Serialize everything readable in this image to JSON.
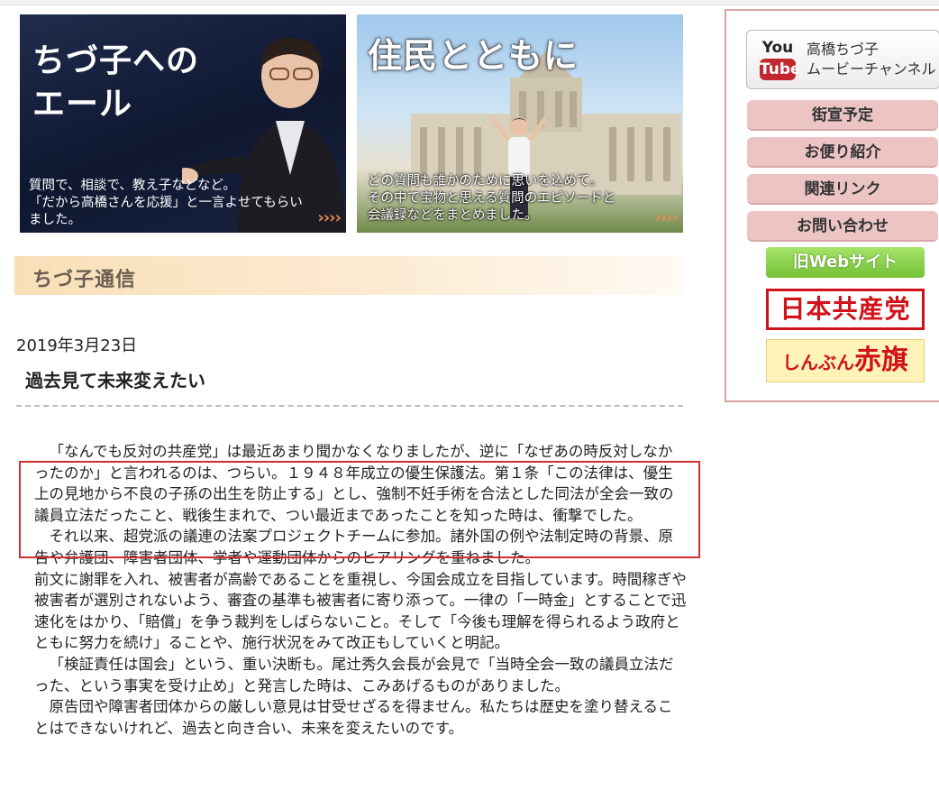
{
  "banners": [
    {
      "title": "ちづ子への\nエール",
      "caption": "質問で、相談で、教え子などなど。\n「だから高橋さんを応援」と一言よせてもらい\nました。",
      "arrow": "››››"
    },
    {
      "title": "住民とともに",
      "caption": "どの質問も誰かのために思いを込めて。\nその中で宝物と思える質問のエピソードと\n会議録などをまとめました。",
      "arrow": "››››"
    }
  ],
  "section": {
    "title": "ちづ子通信"
  },
  "post": {
    "date": "2019年3月23日",
    "title": "過去見て未来変えたい",
    "paragraphs": [
      "「なんでも反対の共産党」は最近あまり聞かなくなりましたが、逆に「なぜあの時反対しなかったのか」と言われるのは、つらい。１９４８年成立の優生保護法。第１条「この法律は、優生上の見地から不良の子孫の出生を防止する」とし、強制不妊手術を合法とした同法が全会一致の議員立法だったこと、戦後生まれで、つい最近まであったことを知った時は、衝撃でした。",
      "それ以来、超党派の議連の法案プロジェクトチームに参加。諸外国の例や法制定時の背景、原告や弁護団、障害者団体、学者や運動団体からのヒアリングを重ねました。",
      "前文に謝罪を入れ、被害者が高齢であることを重視し、今国会成立を目指しています。時間稼ぎや被害者が選別されないよう、審査の基準も被害者に寄り添って。一律の「一時金」とすることで迅速化をはかり、「賠償」を争う裁判をしばらないこと。そして「今後も理解を得られるよう政府とともに努力を続け」ることや、施行状況をみて改正もしていくと明記。",
      "「検証責任は国会」という、重い決断も。尾辻秀久会長が会見で「当時全会一致の議員立法だった、という事実を受け止め」と発言した時は、こみあげるものがありました。",
      "原告団や障害者団体からの厳しい意見は甘受せざるを得ません。私たちは歴史を塗り替えることはできないけれど、過去と向き合い、未来を変えたいのです。"
    ]
  },
  "sidebar": {
    "youtube": {
      "logo_top": "You",
      "logo_bottom": "Tube",
      "label": "高橋ちづ子\nムービーチャンネル"
    },
    "nav": [
      "街宣予定",
      "お便り紹介",
      "関連リンク",
      "お問い合わせ"
    ],
    "old_web": "旧Webサイト",
    "jcp": "日本共産党",
    "akahata_small": "しんぶん",
    "akahata_big": "赤旗"
  },
  "colors": {
    "highlight_border": "#d03030",
    "nav_button": "#ecc4c4",
    "sidebar_border": "#d9a2a2",
    "jcp_red": "#d0121b",
    "section_header": "#f9dfb8"
  }
}
